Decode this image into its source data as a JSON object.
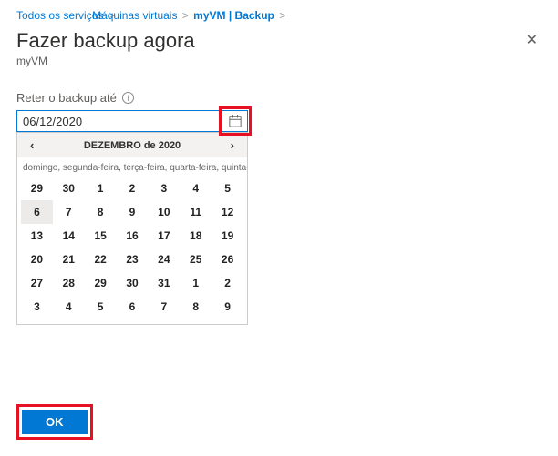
{
  "breadcrumb": {
    "item1": "Todos os serviços",
    "item2": "Máquinas virtuais",
    "item3": "myVM | Backup"
  },
  "header": {
    "title": "Fazer backup agora",
    "subtitle": "myVM"
  },
  "field": {
    "label": "Reter o backup até",
    "value": "06/12/2020"
  },
  "calendar": {
    "month_label": "DEZEMBRO de 2020",
    "weekday_row": "domingo, segunda-feira, terça-feira, quarta-feira, quinta-feira, sexta-feira, sábado",
    "selected_day": "6",
    "days": [
      "29",
      "30",
      "1",
      "2",
      "3",
      "4",
      "5",
      "6",
      "7",
      "8",
      "9",
      "10",
      "11",
      "12",
      "13",
      "14",
      "15",
      "16",
      "17",
      "18",
      "19",
      "20",
      "21",
      "22",
      "23",
      "24",
      "25",
      "26",
      "27",
      "28",
      "29",
      "30",
      "31",
      "1",
      "2",
      "3",
      "4",
      "5",
      "6",
      "7",
      "8",
      "9"
    ]
  },
  "buttons": {
    "ok": "OK"
  },
  "colors": {
    "accent": "#0078d4",
    "highlight": "#e81123"
  }
}
